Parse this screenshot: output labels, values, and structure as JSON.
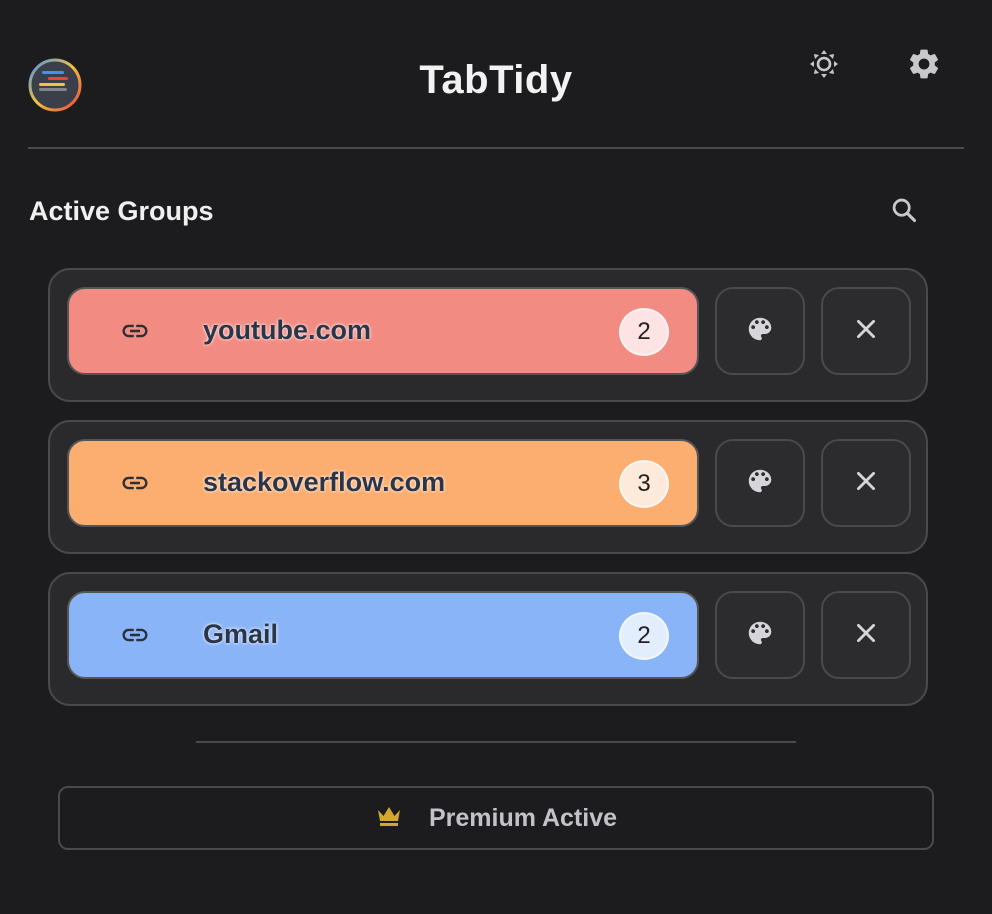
{
  "header": {
    "app_title": "TabTidy",
    "logo_icon": "tabtidy-logo",
    "theme_icon": "brightness-icon",
    "settings_icon": "gear-icon"
  },
  "section": {
    "title": "Active Groups",
    "search_icon": "search-icon"
  },
  "groups": [
    {
      "name": "youtube.com",
      "count": "2",
      "color": "#f28b82",
      "badge_bg": "#fde3e1"
    },
    {
      "name": "stackoverflow.com",
      "count": "3",
      "color": "#fcad70",
      "badge_bg": "#feeadb"
    },
    {
      "name": "Gmail",
      "count": "2",
      "color": "#8ab4f8",
      "badge_bg": "#e2edfd"
    }
  ],
  "premium": {
    "label": "Premium Active",
    "icon": "crown-icon",
    "icon_color": "#d4a72c"
  },
  "colors": {
    "background": "#1c1c1e",
    "card": "#2a2a2c",
    "border": "#4a4a4e"
  }
}
